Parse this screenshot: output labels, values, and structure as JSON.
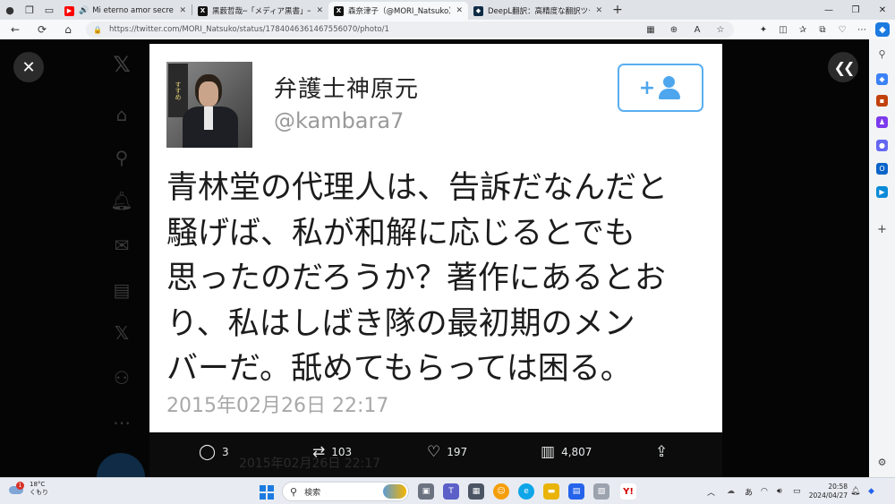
{
  "browser": {
    "tabs": [
      {
        "title": "Mi eterno amor secreto - Yo",
        "favicon": "youtube-icon",
        "audio": true,
        "active": false
      },
      {
        "title": "黒薮哲哉─「メディア黒書」─「押し紙",
        "favicon": "x-icon",
        "audio": false,
        "active": false
      },
      {
        "title": "森奈津子（@MORI_Natsuko）さ",
        "favicon": "x-icon",
        "audio": false,
        "active": true
      },
      {
        "title": "DeepL翻訳：高精度な翻訳ツール",
        "favicon": "deepl-icon",
        "audio": false,
        "active": false
      }
    ],
    "url": "https://twitter.com/MORI_Natsuko/status/1784046361467556070/photo/1"
  },
  "photo": {
    "account_name": "弁護士神原元",
    "account_handle": "@kambara7",
    "avatar_sign_text": "すすめ",
    "tweet_lines": [
      "青林堂の代理人は、告訴だなんだと",
      "騒げば、私が和解に応じるとでも",
      "思ったのだろうか？著作にあるとお",
      "り、私はしばき隊の最初期のメン",
      "バーだ。舐めてもらっては困る。"
    ],
    "tweet_date": "2015年02月26日 22:17"
  },
  "background_ghost_text": "2015年02月26日 22:17",
  "actions": {
    "replies": "3",
    "reposts": "103",
    "likes": "197",
    "views": "4,807"
  },
  "taskbar": {
    "weather_temp": "18°C",
    "weather_desc": "くもり",
    "weather_badge": "1",
    "search_placeholder": "検索",
    "ime_label": "あ",
    "time": "20:58",
    "date": "2024/04/27"
  },
  "colors": {
    "accent_blue": "#4ea7ee",
    "youtube_red": "#ff0000",
    "page_bg": "#000000"
  }
}
